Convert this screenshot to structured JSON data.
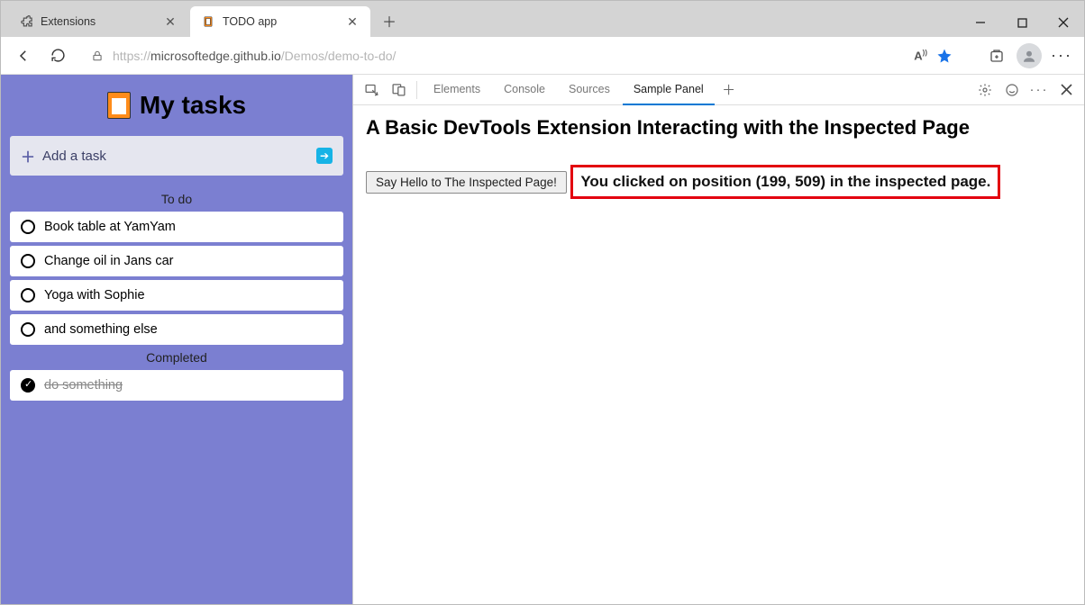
{
  "browser": {
    "tabs": [
      {
        "label": "Extensions",
        "active": false
      },
      {
        "label": "TODO app",
        "active": true
      }
    ],
    "url_dim_prefix": "https://",
    "url_host": "microsoftedge.github.io",
    "url_path": "/Demos/demo-to-do/"
  },
  "app": {
    "title": "My tasks",
    "add_placeholder": "Add a task",
    "sections": {
      "todo_label": "To do",
      "completed_label": "Completed"
    },
    "todo": [
      "Book table at YamYam",
      "Change oil in Jans car",
      "Yoga with Sophie",
      "and something else"
    ],
    "completed": [
      "do something"
    ]
  },
  "devtools": {
    "tabs": [
      "Elements",
      "Console",
      "Sources",
      "Sample Panel"
    ],
    "active_tab": "Sample Panel",
    "heading": "A Basic DevTools Extension Interacting with the Inspected Page",
    "button_label": "Say Hello to The Inspected Page!",
    "message": "You clicked on position (199, 509) in the inspected page."
  }
}
